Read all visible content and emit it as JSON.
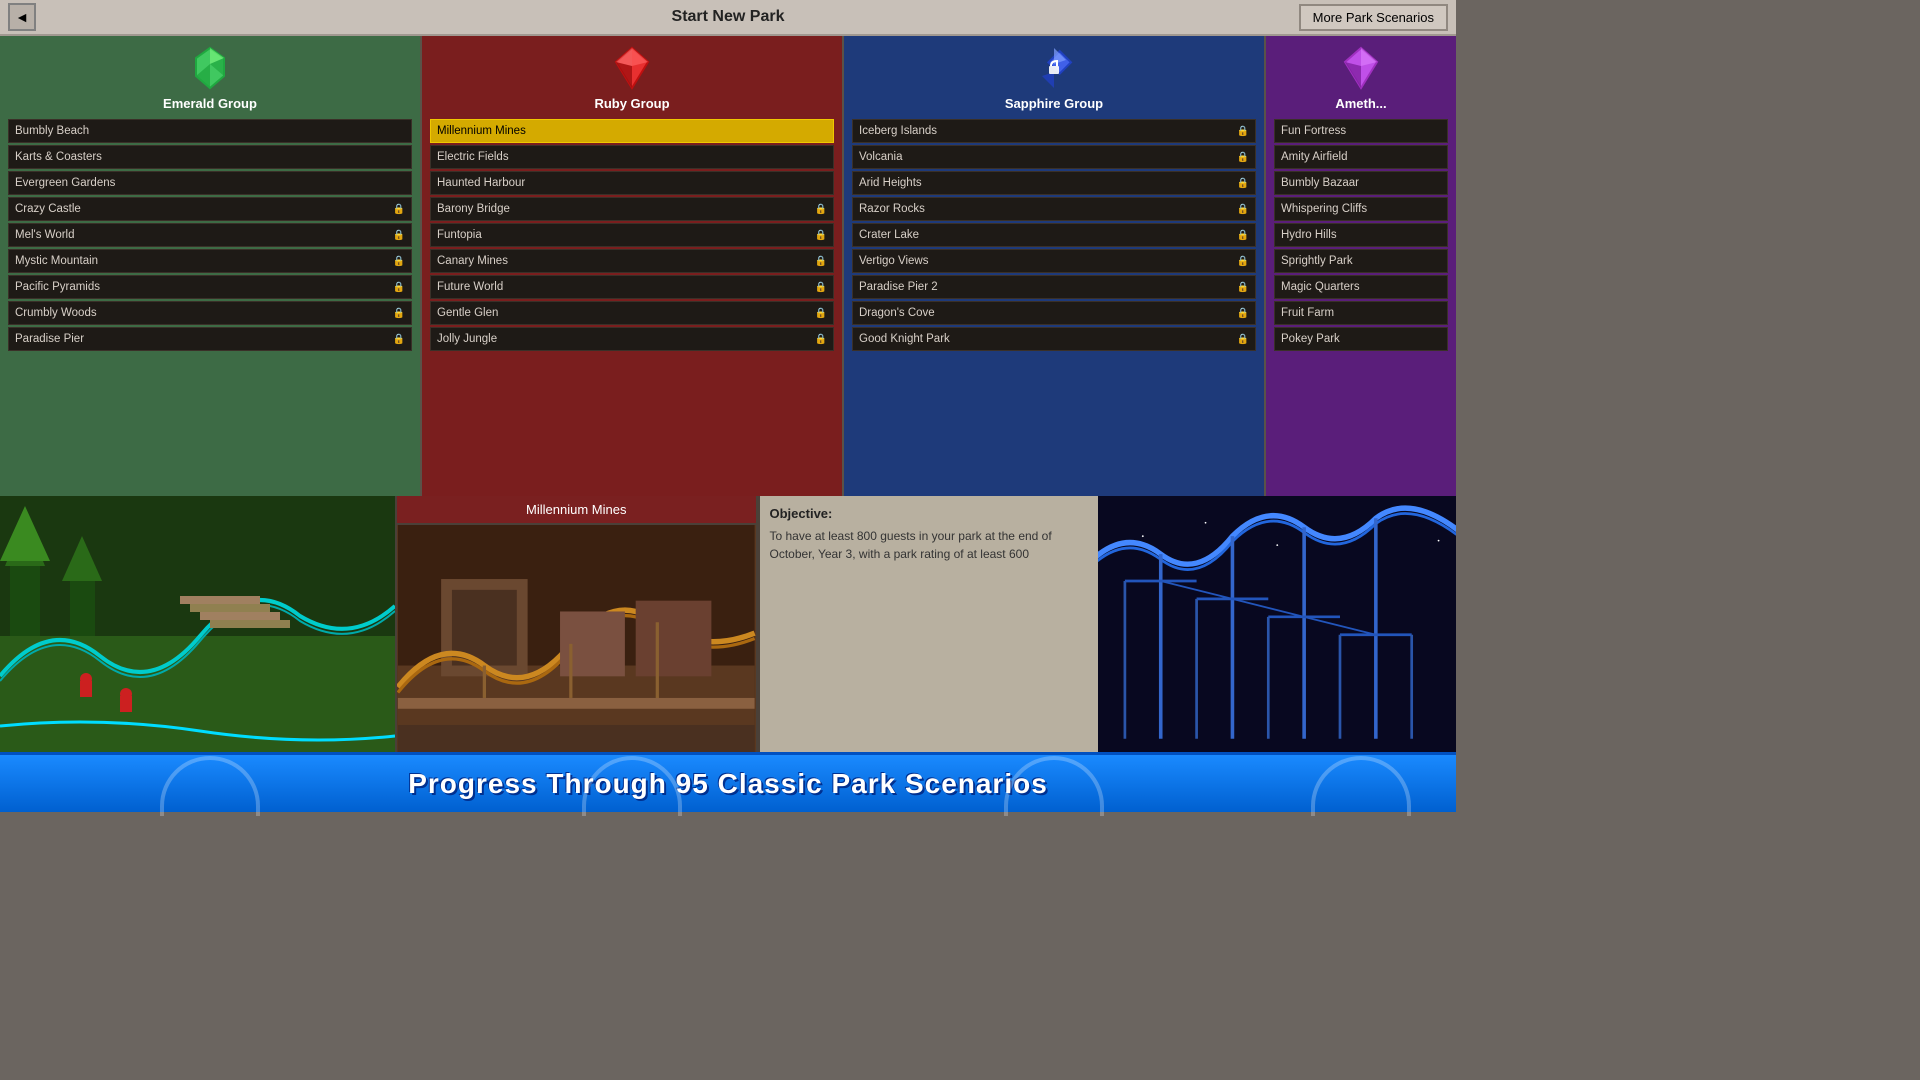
{
  "titleBar": {
    "title": "Start New Park",
    "moreButton": "More Park Scenarios",
    "backIcon": "◄"
  },
  "groups": [
    {
      "id": "emerald",
      "name": "Emerald Group",
      "gemColor": "#50e870",
      "scenarios": [
        {
          "name": "Bumbly Beach",
          "locked": false
        },
        {
          "name": "Karts & Coasters",
          "locked": false
        },
        {
          "name": "Evergreen Gardens",
          "locked": false
        },
        {
          "name": "Crazy Castle",
          "locked": true
        },
        {
          "name": "Mel's World",
          "locked": true
        },
        {
          "name": "Mystic Mountain",
          "locked": true
        },
        {
          "name": "Pacific Pyramids",
          "locked": true
        },
        {
          "name": "Crumbly Woods",
          "locked": true
        },
        {
          "name": "Paradise Pier",
          "locked": true
        }
      ]
    },
    {
      "id": "ruby",
      "name": "Ruby Group",
      "gemColor": "#e83030",
      "scenarios": [
        {
          "name": "Millennium Mines",
          "locked": false,
          "selected": true
        },
        {
          "name": "Electric Fields",
          "locked": false
        },
        {
          "name": "Haunted Harbour",
          "locked": false
        },
        {
          "name": "Barony Bridge",
          "locked": true
        },
        {
          "name": "Funtopia",
          "locked": true
        },
        {
          "name": "Canary Mines",
          "locked": true
        },
        {
          "name": "Future World",
          "locked": true
        },
        {
          "name": "Gentle Glen",
          "locked": true
        },
        {
          "name": "Jolly Jungle",
          "locked": true
        }
      ]
    },
    {
      "id": "sapphire",
      "name": "Sapphire Group",
      "gemColor": "#3050e8",
      "scenarios": [
        {
          "name": "Iceberg Islands",
          "locked": true
        },
        {
          "name": "Volcania",
          "locked": true
        },
        {
          "name": "Arid Heights",
          "locked": true
        },
        {
          "name": "Razor Rocks",
          "locked": true
        },
        {
          "name": "Crater Lake",
          "locked": true
        },
        {
          "name": "Vertigo Views",
          "locked": true
        },
        {
          "name": "Paradise Pier 2",
          "locked": true
        },
        {
          "name": "Dragon's Cove",
          "locked": true
        },
        {
          "name": "Good Knight Park",
          "locked": true
        }
      ]
    },
    {
      "id": "amethyst",
      "name": "Amethyst Group",
      "gemColor": "#c050e8",
      "scenarios": [
        {
          "name": "Fun Fortress",
          "locked": false
        },
        {
          "name": "Amity Airfield",
          "locked": false
        },
        {
          "name": "Bumbly Bazaar",
          "locked": false
        },
        {
          "name": "Whispering Cliffs",
          "locked": false
        },
        {
          "name": "Hydro Hills",
          "locked": false
        },
        {
          "name": "Sprightly Park",
          "locked": false
        },
        {
          "name": "Magic Quarters",
          "locked": false
        },
        {
          "name": "Fruit Farm",
          "locked": false
        },
        {
          "name": "Pokey Park",
          "locked": false
        }
      ]
    }
  ],
  "preview": {
    "selectedScenario": "Millennium Mines",
    "objectiveLabel": "Objective:",
    "objectiveText": "To have at least 800 guests in your park at the end of October, Year 3, with a park rating of at least 600"
  },
  "bottomBanner": {
    "text": "Progress Through 95 Classic Park Scenarios"
  }
}
